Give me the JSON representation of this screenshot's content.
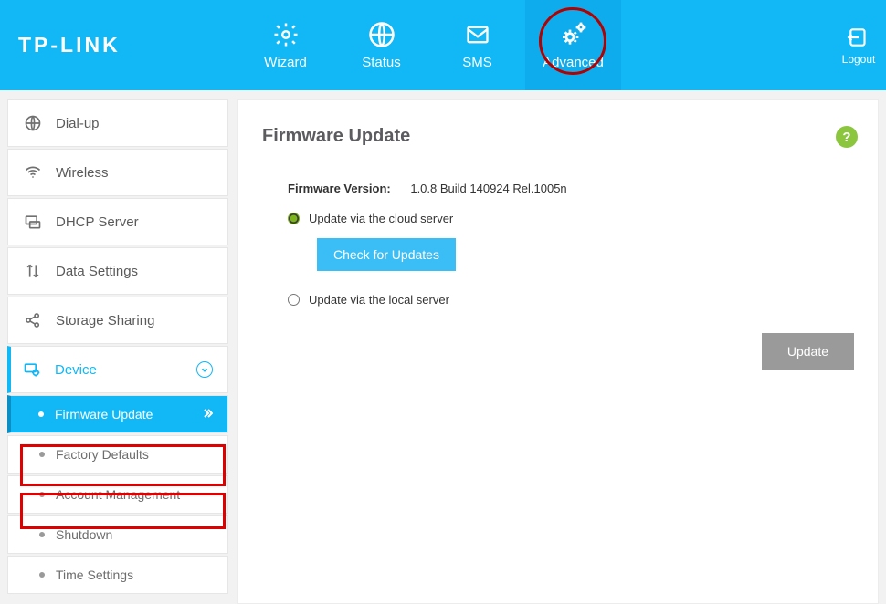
{
  "brand": "TP-LINK",
  "nav": {
    "wizard": "Wizard",
    "status": "Status",
    "sms": "SMS",
    "advanced": "Advanced",
    "logout": "Logout"
  },
  "sidebar": {
    "dialup": "Dial-up",
    "wireless": "Wireless",
    "dhcp": "DHCP Server",
    "data": "Data Settings",
    "storage": "Storage Sharing",
    "device": "Device",
    "sub": {
      "firmware": "Firmware Update",
      "factory": "Factory Defaults",
      "account": "Account Management",
      "shutdown": "Shutdown",
      "time": "Time Settings"
    }
  },
  "panel": {
    "title": "Firmware Update",
    "fw_label": "Firmware Version:",
    "fw_value": "1.0.8 Build 140924 Rel.1005n",
    "opt_cloud": "Update via the cloud server",
    "opt_local": "Update via the local server",
    "check_btn": "Check for Updates",
    "update_btn": "Update",
    "help": "?"
  }
}
